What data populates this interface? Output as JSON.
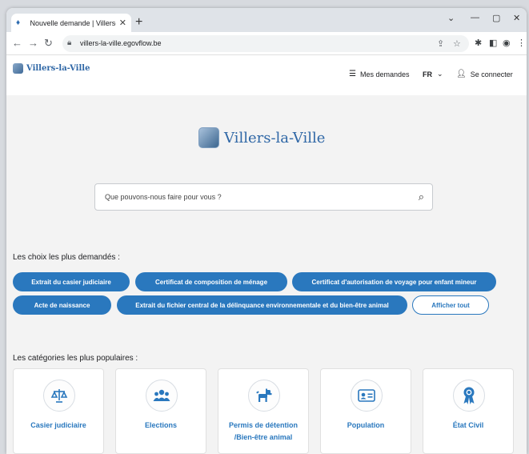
{
  "browser": {
    "tab_title": "Nouvelle demande | Villers-la-V",
    "url": "villers-la-ville.egovflow.be"
  },
  "header": {
    "logo_text": "Villers-la-Ville",
    "my_requests": "Mes demandes",
    "language": "FR",
    "login": "Se connecter"
  },
  "hero": {
    "logo_text": "Villers-la-Ville"
  },
  "search": {
    "placeholder": "Que pouvons-nous faire pour vous ?"
  },
  "popular_choices": {
    "title": "Les choix les plus demandés :",
    "items": [
      "Extrait du casier judiciaire",
      "Certificat de composition de ménage",
      "Certificat d'autorisation de voyage pour enfant mineur",
      "Acte de naissance",
      "Extrait du fichier central de la délinquance environnementale et du bien-être animal"
    ],
    "show_all": "Afficher tout"
  },
  "categories": {
    "title": "Les catégories les plus populaires :",
    "items": [
      {
        "label": "Casier judiciaire",
        "icon": "scales-icon"
      },
      {
        "label": "Elections",
        "icon": "people-icon"
      },
      {
        "label": "Permis de détention /Bien-être animal",
        "icon": "dog-icon"
      },
      {
        "label": "Population",
        "icon": "id-card-icon"
      },
      {
        "label": "État Civil",
        "icon": "rosette-icon"
      }
    ]
  },
  "colors": {
    "accent": "#2a78be",
    "brand_text": "#2f67a6"
  }
}
